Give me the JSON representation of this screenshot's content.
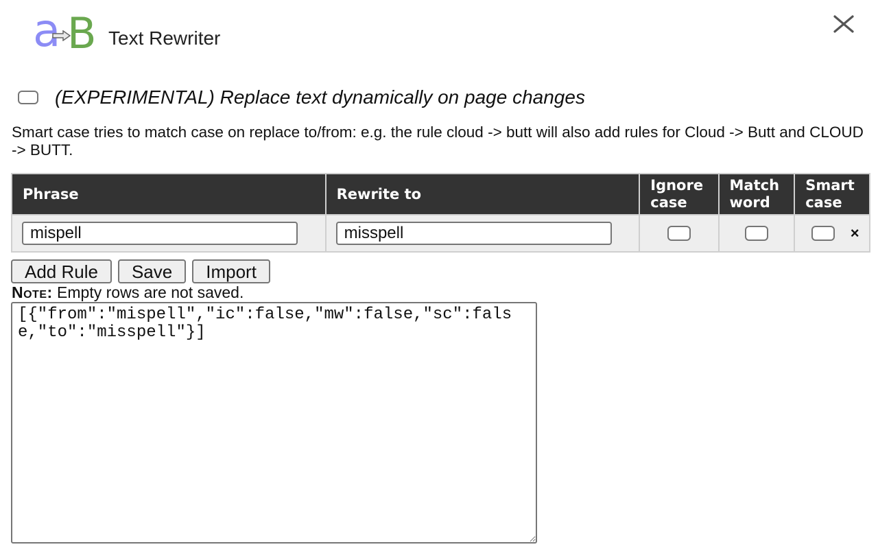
{
  "header": {
    "title": "Text Rewriter",
    "logo_icon": "a-to-b-logo-icon",
    "close_icon": "close-icon"
  },
  "experimental": {
    "checked": false,
    "label": "(EXPERIMENTAL) Replace text dynamically on page changes"
  },
  "description": "Smart case tries to match case on replace to/from: e.g. the rule cloud -> butt will also add rules for Cloud -> Butt and CLOUD -> BUTT.",
  "table": {
    "headers": {
      "phrase": "Phrase",
      "rewrite_to": "Rewrite to",
      "ignore_case": "Ignore case",
      "match_word": "Match word",
      "smart_case": "Smart case"
    },
    "rows": [
      {
        "phrase": "mispell",
        "rewrite_to": "misspell",
        "ignore_case": false,
        "match_word": false,
        "smart_case": false,
        "delete_label": "×"
      }
    ]
  },
  "buttons": {
    "add_rule": "Add Rule",
    "save": "Save",
    "import": "Import"
  },
  "note": {
    "label": "Note:",
    "text": " Empty rows are not saved."
  },
  "json_text": "[{\"from\":\"mispell\",\"ic\":false,\"mw\":false,\"sc\":false,\"to\":\"misspell\"}]",
  "colors": {
    "header_bg": "#333333",
    "row_bg": "#eeeeee",
    "logo_a": "#8c8cf5",
    "logo_b": "#6aa84f"
  }
}
